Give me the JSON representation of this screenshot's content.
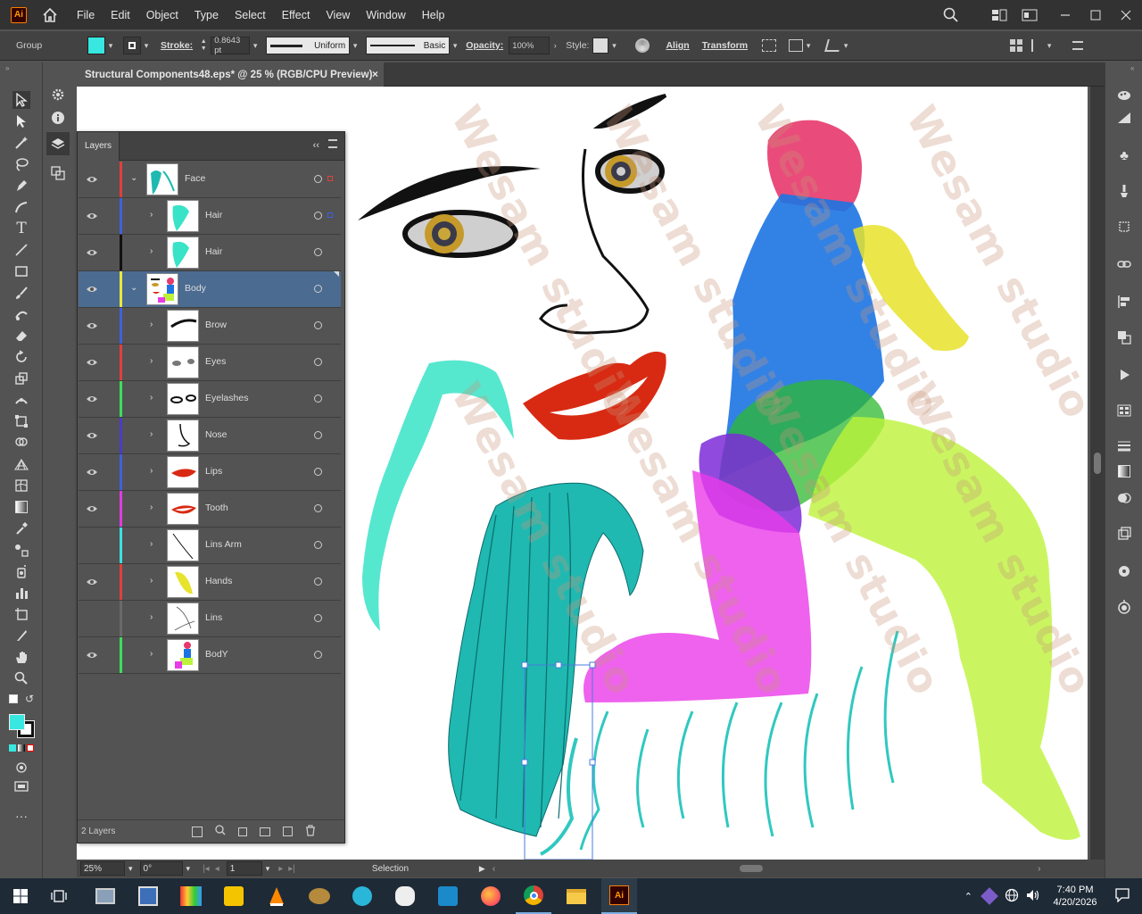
{
  "app": {
    "logo": "Ai",
    "menus": [
      "File",
      "Edit",
      "Object",
      "Type",
      "Select",
      "Effect",
      "View",
      "Window",
      "Help"
    ]
  },
  "control_bar": {
    "selection_type": "Group",
    "fill_color": "#38e8e0",
    "stroke_label": "Stroke:",
    "stroke_value": "0.8643 pt",
    "profile_label": "Uniform",
    "brush_label": "Basic",
    "opacity_label": "Opacity:",
    "opacity_value": "100%",
    "style_label": "Style:",
    "align_label": "Align",
    "transform_label": "Transform"
  },
  "document_tab": {
    "title": "Structural Components48.eps* @ 25 % (RGB/CPU Preview)",
    "close": "×"
  },
  "layers_panel": {
    "tab": "Layers",
    "footer_count": "2 Layers",
    "rows": [
      {
        "name": "Face",
        "color": "#e0403c",
        "level": 0,
        "expanded": true,
        "visible": true
      },
      {
        "name": "Hair",
        "color": "#3c62e0",
        "level": 1,
        "expanded": false,
        "visible": true
      },
      {
        "name": "Hair",
        "color": "#111111",
        "level": 1,
        "expanded": false,
        "visible": true
      },
      {
        "name": "Body",
        "color": "#e8e83c",
        "level": 0,
        "expanded": true,
        "visible": true,
        "selected": true
      },
      {
        "name": "Brow",
        "color": "#3c62e0",
        "level": 1,
        "expanded": false,
        "visible": true
      },
      {
        "name": "Eyes",
        "color": "#e0403c",
        "level": 1,
        "expanded": false,
        "visible": true
      },
      {
        "name": "Eyelashes",
        "color": "#3ce05a",
        "level": 1,
        "expanded": false,
        "visible": true
      },
      {
        "name": "Nose",
        "color": "#4a3cc8",
        "level": 1,
        "expanded": false,
        "visible": true
      },
      {
        "name": "Lips",
        "color": "#3c62e0",
        "level": 1,
        "expanded": false,
        "visible": true
      },
      {
        "name": "Tooth",
        "color": "#e03ce0",
        "level": 1,
        "expanded": false,
        "visible": true
      },
      {
        "name": "Lins Arm",
        "color": "#3ce0e0",
        "level": 1,
        "expanded": false,
        "visible": false
      },
      {
        "name": "Hands",
        "color": "#e0403c",
        "level": 1,
        "expanded": false,
        "visible": true
      },
      {
        "name": "Lins",
        "color": "#6a6a6a",
        "level": 1,
        "expanded": false,
        "visible": false
      },
      {
        "name": "BodY",
        "color": "#3ce05a",
        "level": 1,
        "expanded": false,
        "visible": true
      }
    ]
  },
  "status_bar": {
    "zoom": "25%",
    "rotation": "0°",
    "artboard": "1",
    "tool": "Selection"
  },
  "taskbar": {
    "time": "7:40 PM",
    "date": "4/20/2026"
  },
  "watermark": "Wesam studio"
}
